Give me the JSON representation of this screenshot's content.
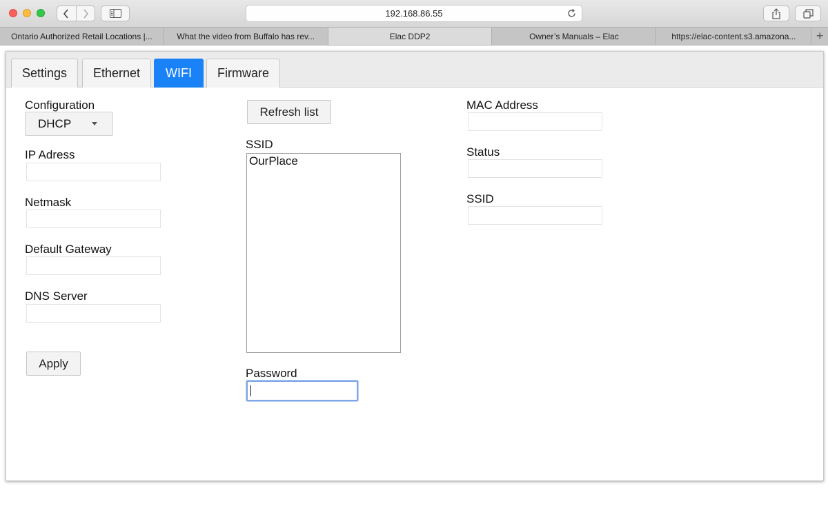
{
  "browser": {
    "url": "192.168.86.55",
    "tabs": [
      {
        "label": "Ontario Authorized Retail Locations |..."
      },
      {
        "label": "What the video from Buffalo has rev..."
      },
      {
        "label": "Elac DDP2"
      },
      {
        "label": "Owner’s Manuals – Elac"
      },
      {
        "label": "https://elac-content.s3.amazona..."
      }
    ],
    "active_tab": 2
  },
  "page": {
    "tabs": [
      {
        "label": "Settings"
      },
      {
        "label": "Ethernet"
      },
      {
        "label": "WIFI"
      },
      {
        "label": "Firmware"
      }
    ],
    "active_tab": "WIFI",
    "left": {
      "configuration_label": "Configuration",
      "configuration_value": "DHCP",
      "ip_label": "IP Adress",
      "ip_value": "",
      "netmask_label": "Netmask",
      "netmask_value": "",
      "gateway_label": "Default Gateway",
      "gateway_value": "",
      "dns_label": "DNS Server",
      "dns_value": "",
      "apply_label": "Apply"
    },
    "middle": {
      "refresh_label": "Refresh list",
      "ssid_label": "SSID",
      "ssid_options": [
        "OurPlace"
      ],
      "password_label": "Password",
      "password_value": ""
    },
    "right": {
      "mac_label": "MAC Address",
      "mac_value": "",
      "status_label": "Status",
      "status_value": "",
      "ssid_label": "SSID",
      "ssid_value": ""
    }
  },
  "colors": {
    "accent": "#1a82f7",
    "focus_ring": "#7fa6e6"
  }
}
